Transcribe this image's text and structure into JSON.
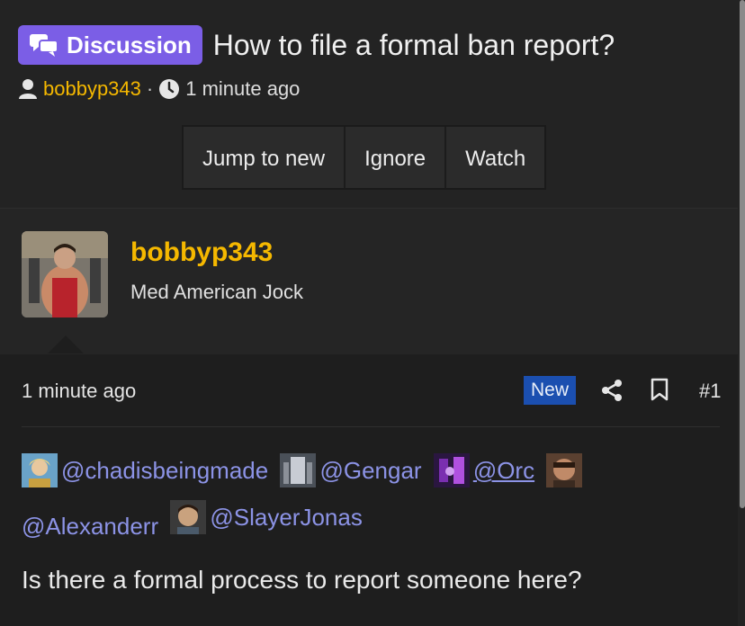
{
  "thread": {
    "badge": "Discussion",
    "title": "How to file a formal ban report?",
    "author": "bobbyp343",
    "separator": "·",
    "time": "1 minute ago"
  },
  "actions": [
    "Jump to new",
    "Ignore",
    "Watch"
  ],
  "user": {
    "name": "bobbyp343",
    "title": "Med American Jock"
  },
  "post": {
    "time": "1 minute ago",
    "new_label": "New",
    "number": "#1",
    "mentions": [
      "@chadisbeingmade",
      "@Gengar",
      "@Orc",
      "@Alexanderr",
      "@SlayerJonas"
    ],
    "text": "Is there a formal process to report someone here?"
  },
  "colors": {
    "accent": "#7b5ee6",
    "username": "#f5b800",
    "mention": "#8c93e6",
    "new_badge": "#1b4fb0"
  }
}
